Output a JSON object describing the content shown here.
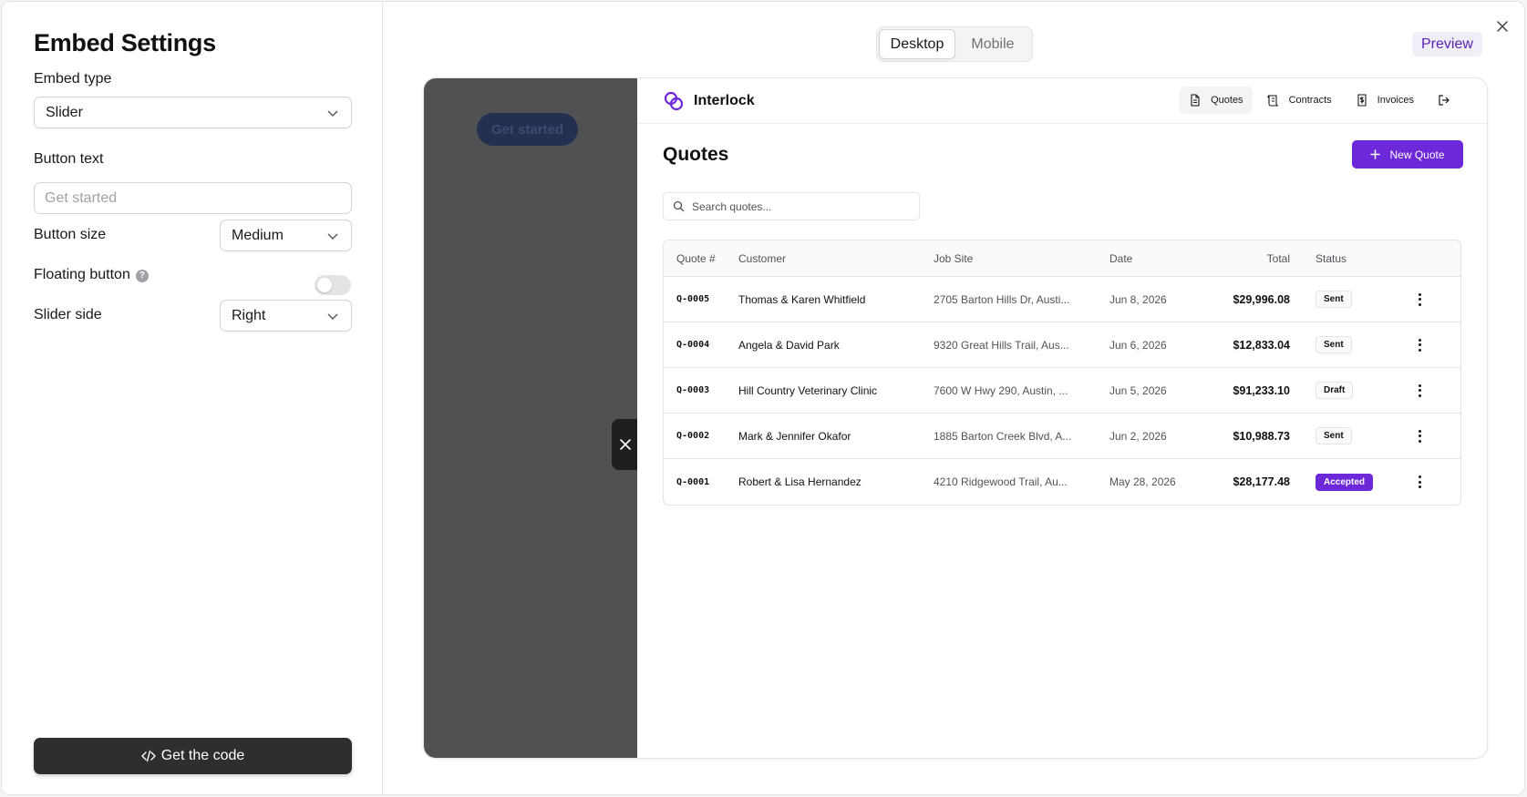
{
  "settings": {
    "title": "Embed Settings",
    "embed_type_label": "Embed type",
    "embed_type_value": "Slider",
    "button_text_label": "Button text",
    "button_text_placeholder": "Get started",
    "button_size_label": "Button size",
    "button_size_value": "Medium",
    "floating_label": "Floating button",
    "floating_enabled": false,
    "slider_side_label": "Slider side",
    "slider_side_value": "Right",
    "get_code_label": "Get the code"
  },
  "view": {
    "desktop": "Desktop",
    "mobile": "Mobile",
    "selected": "Desktop",
    "preview": "Preview"
  },
  "embed_preview": {
    "button_label": "Get started"
  },
  "app": {
    "brand": "Interlock",
    "nav": [
      {
        "label": "Quotes",
        "icon": "document-icon",
        "active": true
      },
      {
        "label": "Contracts",
        "icon": "scroll-icon",
        "active": false
      },
      {
        "label": "Invoices",
        "icon": "dollar-file-icon",
        "active": false
      }
    ],
    "page_title": "Quotes",
    "new_quote_label": "New Quote",
    "search_placeholder": "Search quotes...",
    "columns": [
      "Quote #",
      "Customer",
      "Job Site",
      "Date",
      "Total",
      "Status"
    ],
    "rows": [
      {
        "id": "Q-0005",
        "customer": "Thomas & Karen Whitfield",
        "site": "2705 Barton Hills Dr, Austi...",
        "date": "Jun 8, 2026",
        "total": "$29,996.08",
        "status": "Sent"
      },
      {
        "id": "Q-0004",
        "customer": "Angela & David Park",
        "site": "9320 Great Hills Trail, Aus...",
        "date": "Jun 6, 2026",
        "total": "$12,833.04",
        "status": "Sent"
      },
      {
        "id": "Q-0003",
        "customer": "Hill Country Veterinary Clinic",
        "site": "7600 W Hwy 290, Austin, ...",
        "date": "Jun 5, 2026",
        "total": "$91,233.10",
        "status": "Draft"
      },
      {
        "id": "Q-0002",
        "customer": "Mark & Jennifer Okafor",
        "site": "1885 Barton Creek Blvd, A...",
        "date": "Jun 2, 2026",
        "total": "$10,988.73",
        "status": "Sent"
      },
      {
        "id": "Q-0001",
        "customer": "Robert & Lisa Hernandez",
        "site": "4210 Ridgewood Trail, Au...",
        "date": "May 28, 2026",
        "total": "$28,177.48",
        "status": "Accepted"
      }
    ]
  },
  "colors": {
    "accent": "#6d28d9",
    "overlay": "#505153",
    "dark_button": "#2e2e30"
  }
}
